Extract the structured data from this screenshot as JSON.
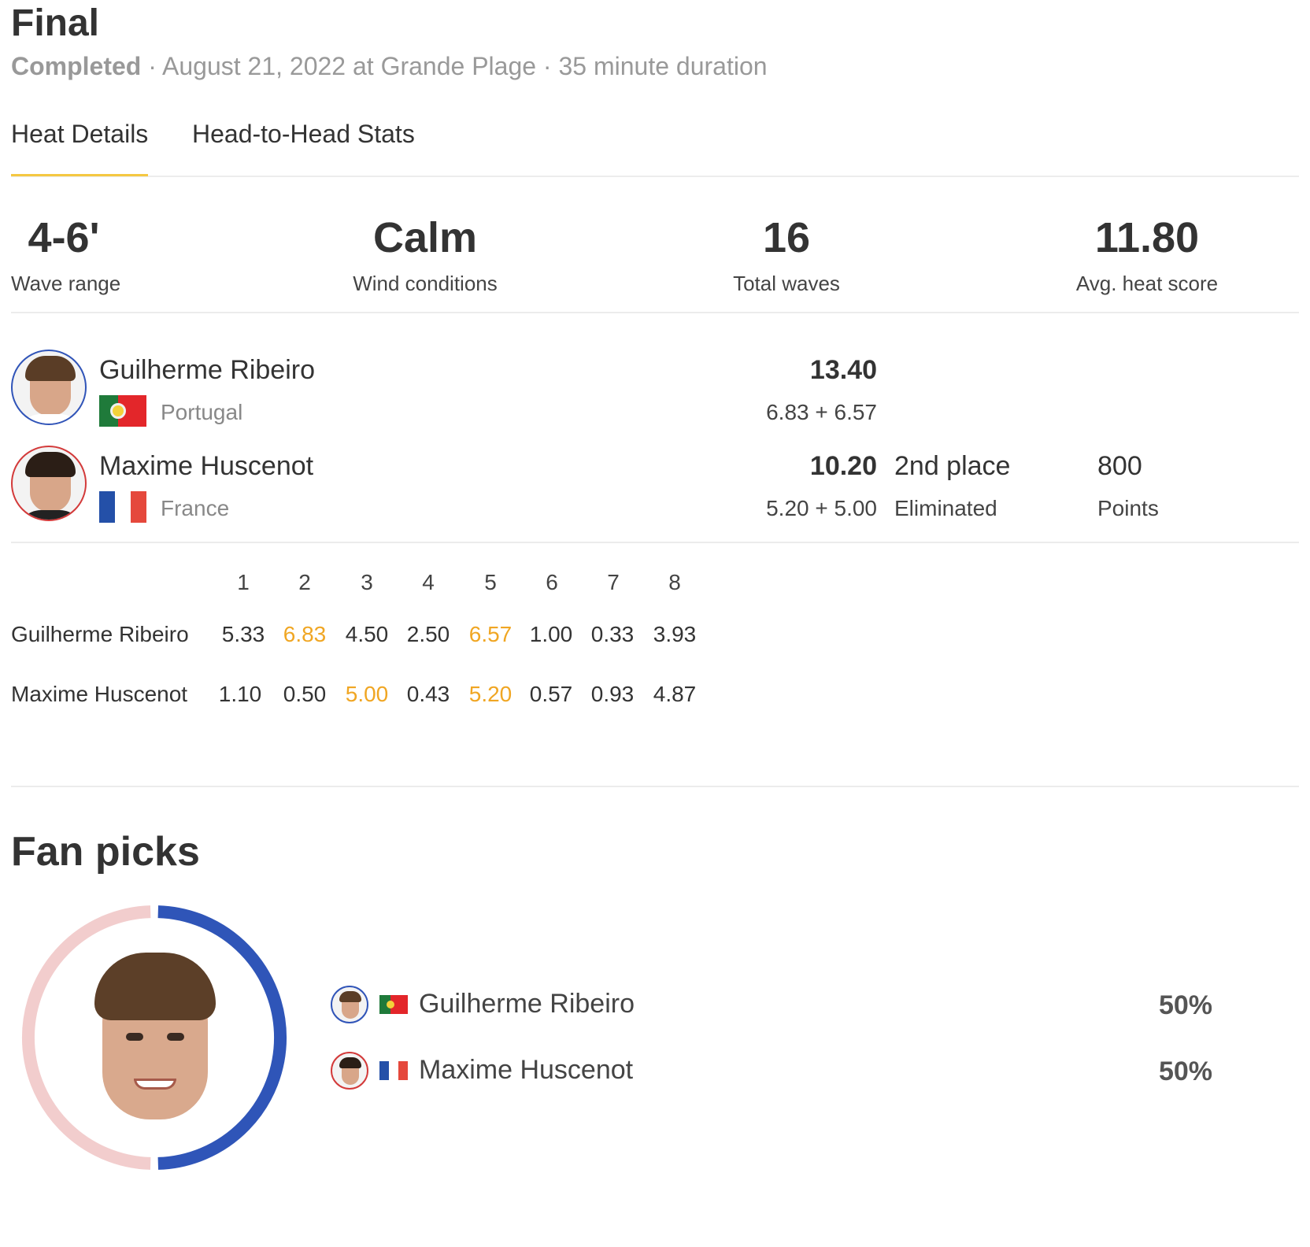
{
  "header": {
    "title": "Final",
    "status": "Completed",
    "details": " · August 21, 2022 at Grande Plage · 35 minute duration"
  },
  "tabs": [
    {
      "label": "Heat Details",
      "active": true
    },
    {
      "label": "Head-to-Head Stats",
      "active": false
    }
  ],
  "stats": [
    {
      "value": "4-6'",
      "label": "Wave range"
    },
    {
      "value": "Calm",
      "label": "Wind conditions"
    },
    {
      "value": "16",
      "label": "Total waves"
    },
    {
      "value": "11.80",
      "label": "Avg. heat score"
    }
  ],
  "athletes": [
    {
      "name": "Guilherme Ribeiro",
      "country": "Portugal",
      "score": "13.40",
      "waves": "6.83 + 6.57",
      "place": "",
      "place_status": "",
      "points": "",
      "points_label": "",
      "accent": "#3054b8"
    },
    {
      "name": "Maxime Huscenot",
      "country": "France",
      "score": "10.20",
      "waves": "5.20 + 5.00",
      "place": "2nd place",
      "place_status": "Eliminated",
      "points": "800",
      "points_label": "Points",
      "accent": "#d33a3a"
    }
  ],
  "wave_table": {
    "headers": [
      "1",
      "2",
      "3",
      "4",
      "5",
      "6",
      "7",
      "8"
    ],
    "rows": [
      {
        "name": "Guilherme Ribeiro",
        "scores": [
          "5.33",
          "6.83",
          "4.50",
          "2.50",
          "6.57",
          "1.00",
          "0.33",
          "3.93"
        ],
        "highlight": [
          1,
          4
        ]
      },
      {
        "name": "Maxime Huscenot",
        "scores": [
          "1.10",
          "0.50",
          "5.00",
          "0.43",
          "5.20",
          "0.57",
          "0.93",
          "4.87"
        ],
        "highlight": [
          2,
          4
        ]
      }
    ],
    "highlight_color": "#f0a623"
  },
  "fan_picks": {
    "title": "Fan picks",
    "picks": [
      {
        "name": "Guilherme Ribeiro",
        "percent": "50%",
        "share": 0.5,
        "color": "#2f55b8"
      },
      {
        "name": "Maxime Huscenot",
        "percent": "50%",
        "share": 0.5,
        "color": "#f2cdcd"
      }
    ]
  }
}
